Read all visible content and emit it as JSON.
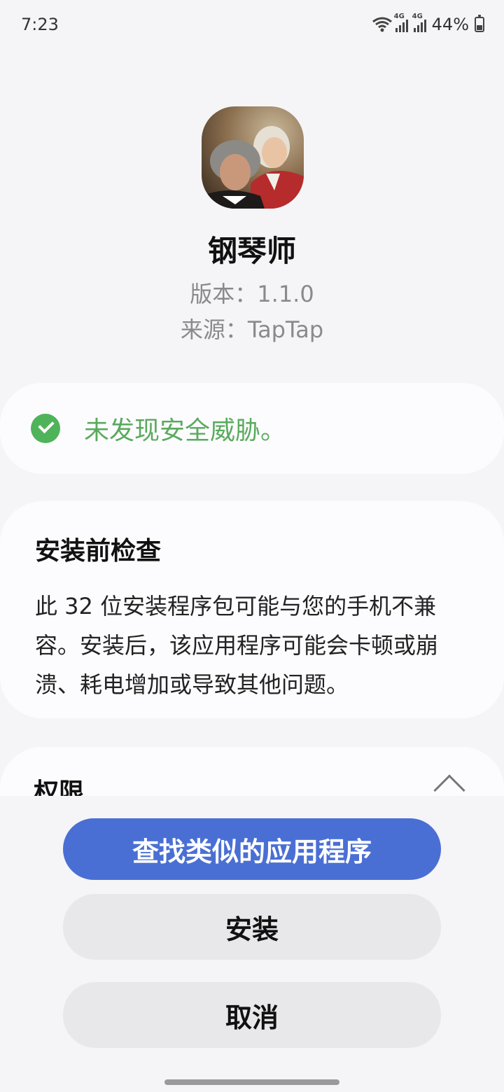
{
  "status_bar": {
    "time": "7:23",
    "network_1": "4G",
    "network_2": "4G",
    "battery": "44%",
    "battery_level": 0.44,
    "icons": [
      "wifi-icon",
      "signal-icon",
      "signal-icon",
      "battery-icon"
    ]
  },
  "app": {
    "name": "钢琴师",
    "version": "版本：1.1.0",
    "source": "来源：TapTap",
    "icon": "composers-portrait-icon"
  },
  "security": {
    "text": "未发现安全威胁。",
    "icon": "check-circle-icon",
    "color": "#4fb35a"
  },
  "precheck": {
    "title": "安装前检查",
    "body": "此 32 位安装程序包可能与您的手机不兼容。安装后，该应用程序可能会卡顿或崩溃、耗电增加或导致其他问题。"
  },
  "permissions": {
    "title": "权限",
    "icon": "chevron-up-icon"
  },
  "buttons": {
    "find_similar": "查找类似的应用程序",
    "install": "安装",
    "cancel": "取消",
    "primary_color": "#4a6fd4"
  }
}
